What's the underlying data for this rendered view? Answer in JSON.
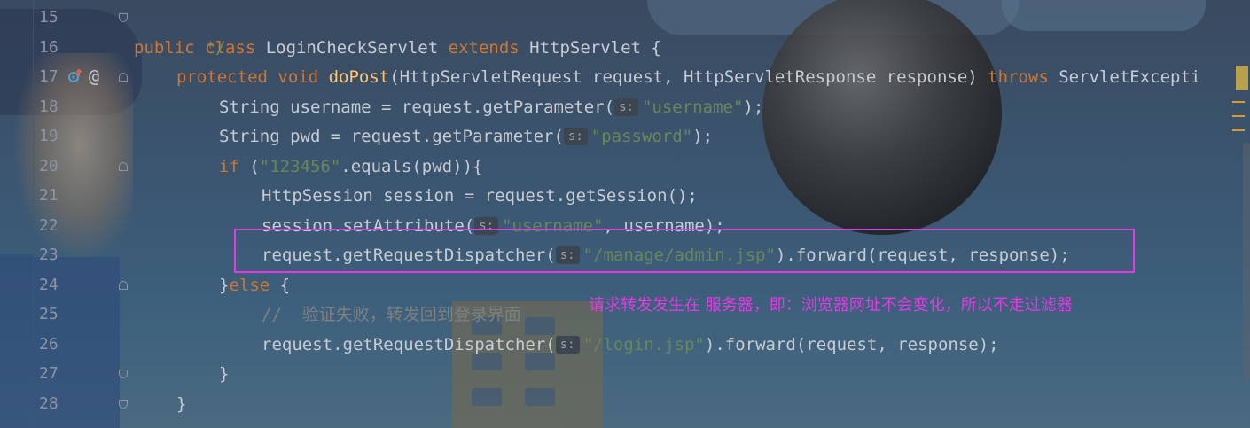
{
  "editor": {
    "first_line_number": 15,
    "accent_color": "#e23be2",
    "keyword_color": "#cc7832",
    "string_color": "#6a8759",
    "function_color": "#ffc66d"
  },
  "lines": [
    {
      "number": "15",
      "doc": "*/"
    },
    {
      "number": "16",
      "kw1": "public class ",
      "name": "LoginCheckServlet ",
      "kw2": "extends ",
      "rest": "HttpServlet {"
    },
    {
      "number": "17",
      "kw1": "protected void ",
      "fn": "doPost",
      "rest1": "(HttpServletRequest request, HttpServletResponse response) ",
      "kw2": "throws ",
      "rest2": "ServletExcepti"
    },
    {
      "number": "18",
      "pre": "String username = request.getParameter(",
      "hint": "s:",
      "str": "\"username\"",
      "post": ");"
    },
    {
      "number": "19",
      "pre": "String pwd = request.getParameter(",
      "hint": "s:",
      "str": "\"password\"",
      "post": ");"
    },
    {
      "number": "20",
      "kw": "if ",
      "pre": "(",
      "str": "\"123456\"",
      "post": ".equals(pwd)){"
    },
    {
      "number": "21",
      "pre": "HttpSession session = request.getSession();"
    },
    {
      "number": "22",
      "pre": "session.setAttribute(",
      "hint": "s:",
      "str": "\"username\"",
      "post": ", username);"
    },
    {
      "number": "23",
      "pre": "request.getRequestDispatcher(",
      "hint": "s:",
      "str": "\"/manage/admin.jsp\"",
      "post": ").forward(request, response);"
    },
    {
      "number": "24",
      "pre": "}",
      "kw": "else ",
      "post": "{"
    },
    {
      "number": "25",
      "cmt": "//  验证失败，转发回到登录界面"
    },
    {
      "number": "26",
      "pre": "request.getRequestDispatcher(",
      "hint": "s:",
      "str": "\"/login.jsp\"",
      "post": ").forward(request, response);"
    },
    {
      "number": "27",
      "pre": "}"
    },
    {
      "number": "28",
      "pre": "}"
    }
  ],
  "annotation_note": "请求转发发生在 服务器，即：浏览器网址不会变化，所以不走过滤器",
  "icons": {
    "override": "override-up-icon",
    "annotation": "at-annotation-icon"
  }
}
